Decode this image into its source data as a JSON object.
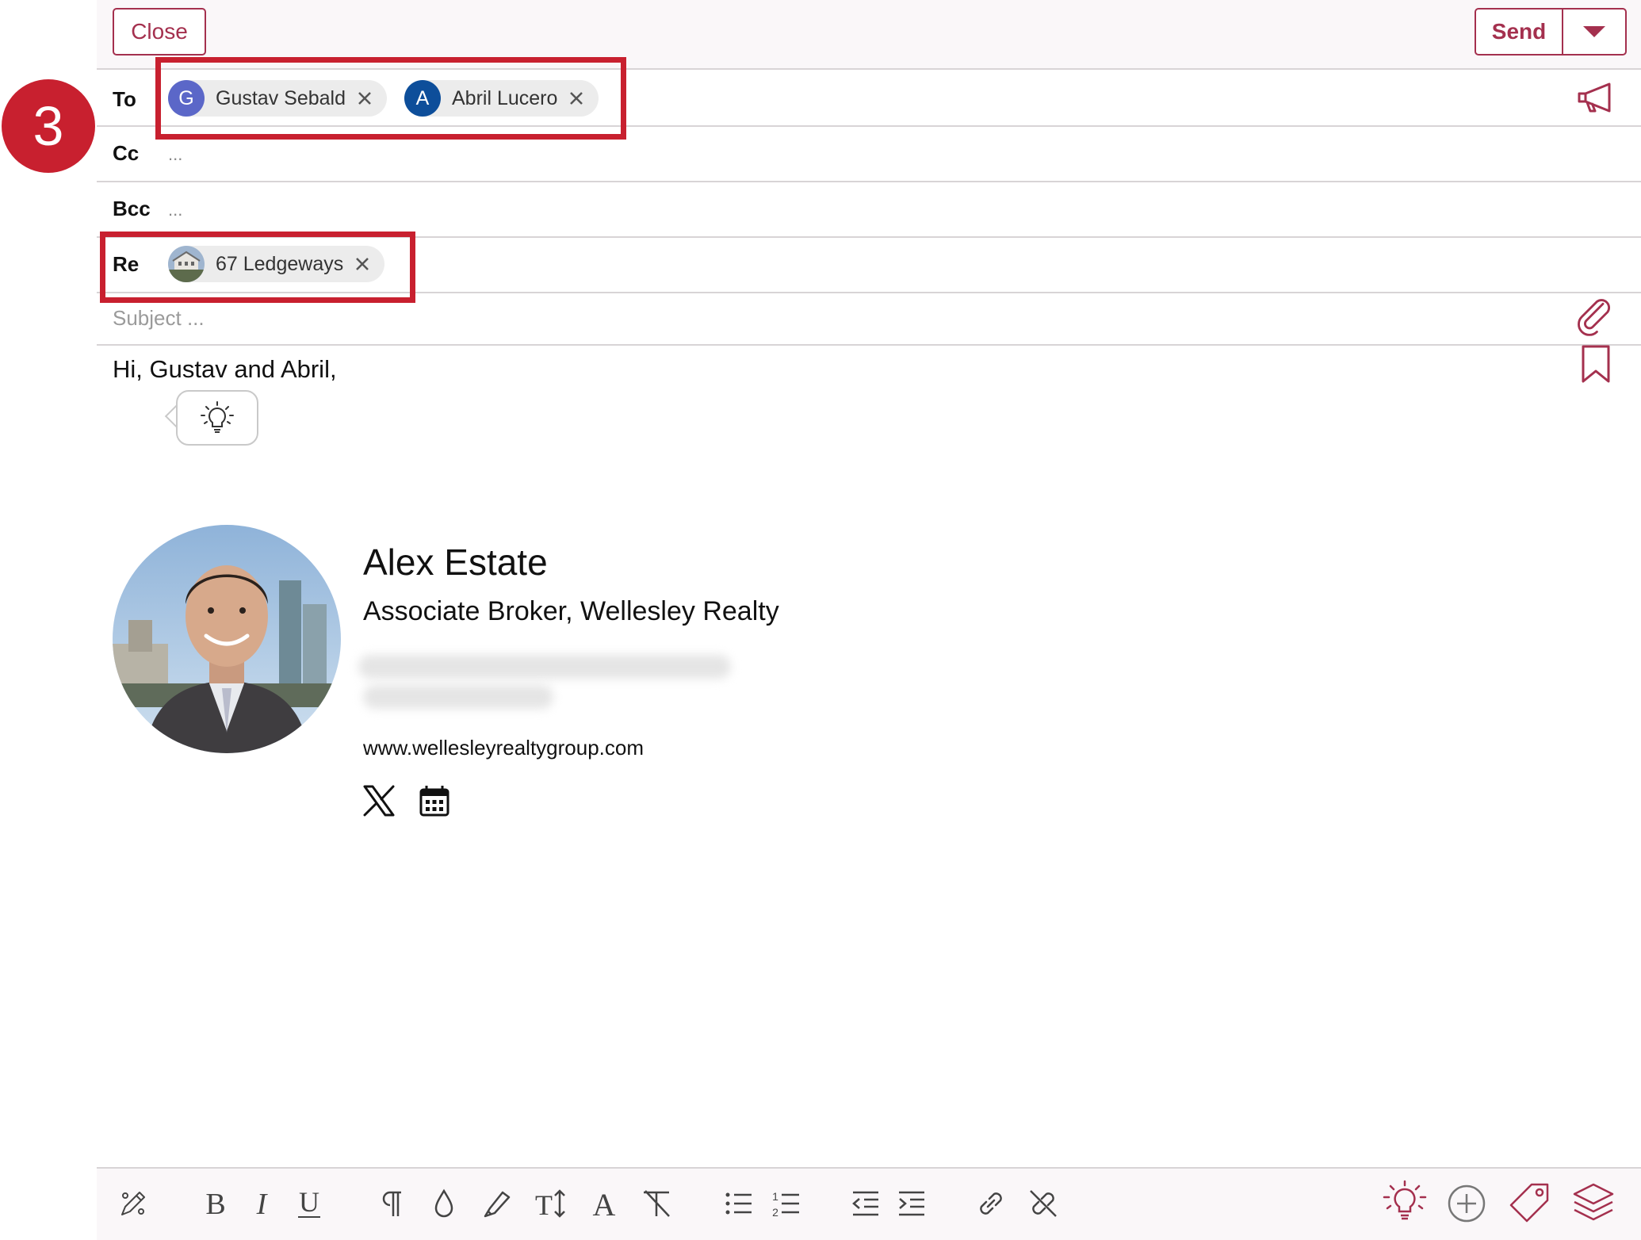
{
  "header": {
    "close_label": "Close",
    "send_label": "Send"
  },
  "step_badge": "3",
  "fields": {
    "to_label": "To",
    "cc_label": "Cc",
    "bcc_label": "Bcc",
    "re_label": "Re",
    "cc_placeholder": "...",
    "bcc_placeholder": "...",
    "subject_placeholder": "Subject ..."
  },
  "recipients": [
    {
      "initial": "G",
      "name": "Gustav Sebald",
      "color": "#5b67c8"
    },
    {
      "initial": "A",
      "name": "Abril Lucero",
      "color": "#0d4e9a"
    }
  ],
  "regarding": {
    "label": "67 Ledgeways"
  },
  "body": {
    "greeting": "Hi, Gustav and Abril,"
  },
  "signature": {
    "name": "Alex Estate",
    "title": "Associate Broker, Wellesley Realty",
    "website": "www.wellesleyrealtygroup.com",
    "social_icons": [
      "x-logo-icon",
      "calendar-icon"
    ]
  },
  "toolbar": {
    "icons": [
      "edit-pencil-icon",
      "bold-icon",
      "italic-icon",
      "underline-icon",
      "paragraph-icon",
      "text-color-icon",
      "highlight-icon",
      "font-size-icon",
      "font-icon",
      "clear-format-icon",
      "bulleted-list-icon",
      "numbered-list-icon",
      "outdent-icon",
      "indent-icon",
      "link-icon",
      "unlink-icon",
      "lightbulb-icon",
      "add-circle-icon",
      "tag-icon",
      "layers-icon"
    ]
  },
  "colors": {
    "accent": "#a4304e",
    "highlight": "#c8202f"
  }
}
